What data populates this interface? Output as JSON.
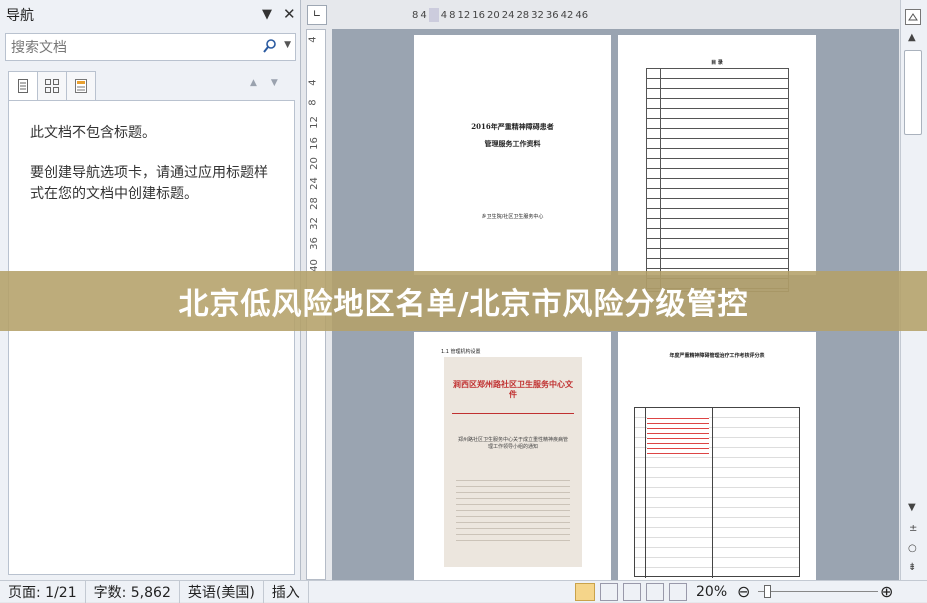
{
  "nav_pane": {
    "title": "导航",
    "search_placeholder": "搜索文档",
    "empty_line1": "此文档不包含标题。",
    "empty_line2": "要创建导航选项卡，请通过应用标题样式在您的文档中创建标题。"
  },
  "vertical_ruler": [
    "4",
    "4",
    "8",
    "12",
    "16",
    "20",
    "24",
    "28",
    "32",
    "36",
    "40"
  ],
  "horizontal_ruler": [
    "8",
    "4",
    "4",
    "8",
    "12",
    "16",
    "20",
    "24",
    "28",
    "32",
    "36",
    "42",
    "46"
  ],
  "pages": {
    "p1_title_line1": "2016年严重精神障碍患者",
    "p1_title_line2": "管理服务工作资料",
    "p1_footer": "乡卫生院/社区卫生服务中心",
    "p2_heading": "目 录",
    "p3_caption": "1.1 管理机构设置",
    "p3_photo_header": "涧西区郑州路社区卫生服务中心文件",
    "p3_photo_title": "郑州路社区卫生服务中心关于成立重性精神疾病管理工作领导小组的通知",
    "p4_heading": "年度严重精神障碍管理治疗工作考核评分表"
  },
  "banner_text": "北京低风险地区名单/北京市风险分级管控",
  "status_bar": {
    "page": "页面: 1/21",
    "words": "字数: 5,862",
    "language": "英语(美国)",
    "mode": "插入",
    "zoom": "20%"
  }
}
